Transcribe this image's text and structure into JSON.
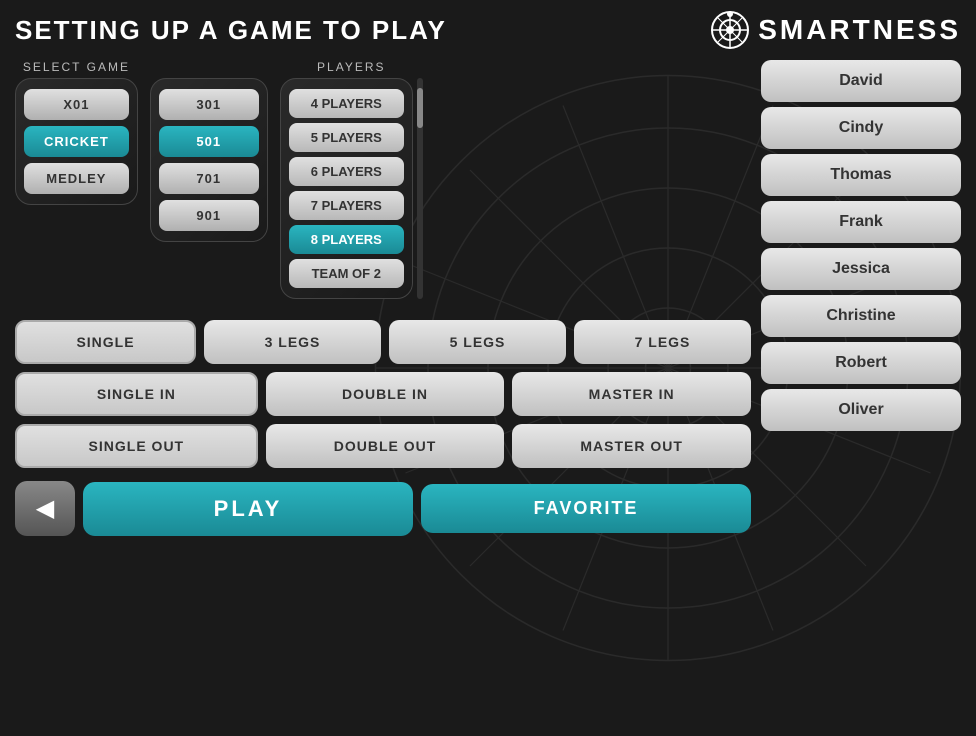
{
  "header": {
    "title": "SETTING UP A GAME TO PLAY",
    "logo_text": "SMARTNESS"
  },
  "select_game": {
    "label": "SELECT GAME",
    "game_types": [
      {
        "id": "x01",
        "label": "X01",
        "active": false
      },
      {
        "id": "cricket",
        "label": "CRICKET",
        "active": true
      },
      {
        "id": "medley",
        "label": "MEDLEY",
        "active": false
      }
    ],
    "scores": [
      {
        "id": "301",
        "label": "301",
        "active": false
      },
      {
        "id": "501",
        "label": "501",
        "active": true
      },
      {
        "id": "701",
        "label": "701",
        "active": false
      },
      {
        "id": "901",
        "label": "901",
        "active": false
      }
    ]
  },
  "players": {
    "label": "PLAYERS",
    "options": [
      {
        "id": "4players",
        "label": "4 PLAYERS",
        "active": false
      },
      {
        "id": "5players",
        "label": "5 PLAYERS",
        "active": false
      },
      {
        "id": "6players",
        "label": "6 PLAYERS",
        "active": false
      },
      {
        "id": "7players",
        "label": "7 PLAYERS",
        "active": false
      },
      {
        "id": "8players",
        "label": "8 PLAYERS",
        "active": true
      },
      {
        "id": "teamof2",
        "label": "TEAM OF 2",
        "active": false
      }
    ]
  },
  "controls": {
    "row1": [
      {
        "id": "single",
        "label": "SINGLE",
        "active": true
      },
      {
        "id": "3legs",
        "label": "3 LEGS",
        "active": false
      },
      {
        "id": "5legs",
        "label": "5 LEGS",
        "active": false
      },
      {
        "id": "7legs",
        "label": "7 LEGS",
        "active": false
      }
    ],
    "row2": [
      {
        "id": "single_in",
        "label": "SINGLE IN",
        "active": true
      },
      {
        "id": "double_in",
        "label": "DOUBLE IN",
        "active": false
      },
      {
        "id": "master_in",
        "label": "MASTER IN",
        "active": false
      }
    ],
    "row3": [
      {
        "id": "single_out",
        "label": "SINGLE OUT",
        "active": true
      },
      {
        "id": "double_out",
        "label": "DOUBLE OUT",
        "active": false
      },
      {
        "id": "master_out",
        "label": "MASTER OUT",
        "active": false
      }
    ]
  },
  "actions": {
    "back_icon": "◀",
    "play_label": "PLAY",
    "favorite_label": "FAVORITE"
  },
  "player_names": [
    {
      "id": "david",
      "name": "David"
    },
    {
      "id": "cindy",
      "name": "Cindy"
    },
    {
      "id": "thomas",
      "name": "Thomas"
    },
    {
      "id": "frank",
      "name": "Frank"
    },
    {
      "id": "jessica",
      "name": "Jessica"
    },
    {
      "id": "christine",
      "name": "Christine"
    },
    {
      "id": "robert",
      "name": "Robert"
    },
    {
      "id": "oliver",
      "name": "Oliver"
    }
  ]
}
